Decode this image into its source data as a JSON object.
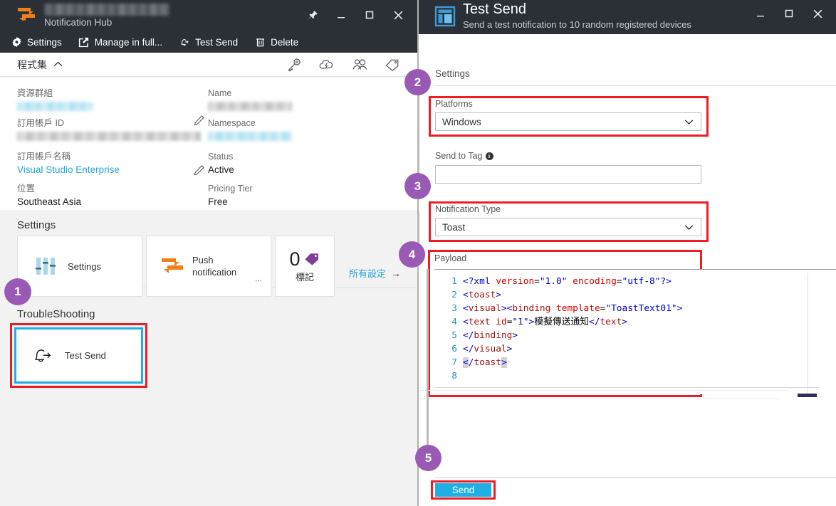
{
  "left_window": {
    "titlebar": {
      "subtitle": "Notification Hub",
      "logo_icon": "notification-hub-logo-icon",
      "buttons": [
        {
          "name": "pin-button",
          "icon": "pin-icon"
        },
        {
          "name": "minimize-button",
          "icon": "minimize-icon"
        },
        {
          "name": "maximize-button",
          "icon": "maximize-icon"
        },
        {
          "name": "close-button",
          "icon": "close-icon"
        }
      ]
    },
    "toolbar": [
      {
        "label": "Settings",
        "icon": "gear-icon"
      },
      {
        "label": "Manage in full...",
        "icon": "external-link-icon"
      },
      {
        "label": "Test Send",
        "icon": "bell-send-icon"
      },
      {
        "label": "Delete",
        "icon": "trash-icon"
      }
    ],
    "essentials": {
      "title": "程式集",
      "collapse_icon": "chevron-up-icon",
      "header_icons": [
        {
          "name": "key-icon"
        },
        {
          "name": "cloud-lightning-icon"
        },
        {
          "name": "users-icon"
        },
        {
          "name": "tag-icon"
        }
      ],
      "properties_left": [
        {
          "label": "資源群組",
          "value": "",
          "redacted": "blue",
          "edit_icon": "pencil-icon"
        },
        {
          "label": "訂用帳戶 ID",
          "value": "",
          "redacted": "gray"
        },
        {
          "label": "訂用帳戶名稱",
          "value": "Visual Studio Enterprise",
          "is_link": true,
          "edit_icon": "pencil-icon"
        },
        {
          "label": "位置",
          "value": "Southeast Asia"
        }
      ],
      "properties_right": [
        {
          "label": "Name",
          "value": "",
          "redacted": "gray"
        },
        {
          "label": "Namespace",
          "value": "",
          "redacted": "blue"
        },
        {
          "label": "Status",
          "value": "Active"
        },
        {
          "label": "Pricing Tier",
          "value": "Free"
        }
      ],
      "all_settings_link": "所有設定",
      "all_settings_arrow": "→"
    },
    "settings_section": {
      "title": "Settings",
      "tiles": [
        {
          "label": "Settings",
          "icon": "sliders-icon"
        },
        {
          "label_line1": "Push",
          "label_line2": "notification",
          "ellipsis": "...",
          "icon": "push-notification-icon"
        },
        {
          "count": "0",
          "label": "標記",
          "icon": "tag-purple-icon"
        }
      ]
    },
    "troubleshooting_section": {
      "title": "TroubleShooting",
      "tile": {
        "label": "Test Send",
        "icon": "bell-send-icon"
      }
    }
  },
  "right_panel": {
    "header": {
      "title": "Test Send",
      "subtitle": "Send a test notification to 10 random registered devices",
      "icon": "blade-icon",
      "buttons": [
        {
          "name": "minimize-button",
          "icon": "minimize-icon"
        },
        {
          "name": "maximize-button",
          "icon": "maximize-icon"
        },
        {
          "name": "close-button",
          "icon": "close-icon"
        }
      ]
    },
    "settings_label": "Settings",
    "platforms": {
      "label": "Platforms",
      "value": "Windows",
      "chevron_icon": "chevron-down-icon"
    },
    "send_to_tag": {
      "label": "Send to Tag",
      "value": "",
      "placeholder": "",
      "info_icon": "info-icon",
      "info_glyph": "i"
    },
    "notification_type": {
      "label": "Notification Type",
      "value": "Toast",
      "chevron_icon": "chevron-down-icon"
    },
    "payload": {
      "label": "Payload",
      "lines": [
        {
          "num": "1",
          "tokens": [
            {
              "t": "<?xml ",
              "c": "c-tag"
            },
            {
              "t": "version",
              "c": "c-attr"
            },
            {
              "t": "=",
              "c": "c-txt"
            },
            {
              "t": "\"1.0\"",
              "c": "c-val"
            },
            {
              "t": " ",
              "c": "c-txt"
            },
            {
              "t": "encoding",
              "c": "c-attr"
            },
            {
              "t": "=",
              "c": "c-txt"
            },
            {
              "t": "\"utf-8\"",
              "c": "c-val"
            },
            {
              "t": "?>",
              "c": "c-tag"
            }
          ]
        },
        {
          "num": "2",
          "tokens": [
            {
              "t": "<",
              "c": "c-tag"
            },
            {
              "t": "toast",
              "c": "c-name"
            },
            {
              "t": ">",
              "c": "c-tag"
            }
          ]
        },
        {
          "num": "3",
          "tokens": [
            {
              "t": "<",
              "c": "c-tag"
            },
            {
              "t": "visual",
              "c": "c-name"
            },
            {
              "t": "><",
              "c": "c-tag"
            },
            {
              "t": "binding",
              "c": "c-name"
            },
            {
              "t": " ",
              "c": "c-txt"
            },
            {
              "t": "template",
              "c": "c-attr"
            },
            {
              "t": "=",
              "c": "c-txt"
            },
            {
              "t": "\"ToastText01\"",
              "c": "c-val"
            },
            {
              "t": ">",
              "c": "c-tag"
            }
          ]
        },
        {
          "num": "4",
          "tokens": [
            {
              "t": "<",
              "c": "c-tag"
            },
            {
              "t": "text",
              "c": "c-name"
            },
            {
              "t": " ",
              "c": "c-txt"
            },
            {
              "t": "id",
              "c": "c-attr"
            },
            {
              "t": "=",
              "c": "c-txt"
            },
            {
              "t": "\"1\"",
              "c": "c-val"
            },
            {
              "t": ">",
              "c": "c-tag"
            },
            {
              "t": "模擬傳送通知",
              "c": "c-txt"
            },
            {
              "t": "</",
              "c": "c-tag"
            },
            {
              "t": "text",
              "c": "c-name"
            },
            {
              "t": ">",
              "c": "c-tag"
            }
          ]
        },
        {
          "num": "5",
          "tokens": [
            {
              "t": "</",
              "c": "c-tag"
            },
            {
              "t": "binding",
              "c": "c-name"
            },
            {
              "t": ">",
              "c": "c-tag"
            }
          ]
        },
        {
          "num": "6",
          "tokens": [
            {
              "t": "</",
              "c": "c-tag"
            },
            {
              "t": "visual",
              "c": "c-name"
            },
            {
              "t": ">",
              "c": "c-tag"
            }
          ]
        },
        {
          "num": "7",
          "tokens": [
            {
              "t": "<",
              "c": "c-tag brk-hl"
            },
            {
              "t": "/",
              "c": "c-tag"
            },
            {
              "t": "toast",
              "c": "c-name"
            },
            {
              "t": ">",
              "c": "c-tag brk-hl"
            }
          ]
        },
        {
          "num": "8",
          "tokens": []
        }
      ]
    },
    "send_button": {
      "label": "Send"
    }
  },
  "step_badges": [
    {
      "num": "1"
    },
    {
      "num": "2"
    },
    {
      "num": "3"
    },
    {
      "num": "4"
    },
    {
      "num": "5"
    }
  ],
  "colors": {
    "accent_blue": "#1eb0e2",
    "highlight_red": "#ee1c25",
    "badge_purple": "#9b59b6",
    "titlebar_dark": "#2b3036",
    "link_blue": "#29a5d6",
    "orange": "#f0811a",
    "purple_tag": "#7e3f98"
  }
}
